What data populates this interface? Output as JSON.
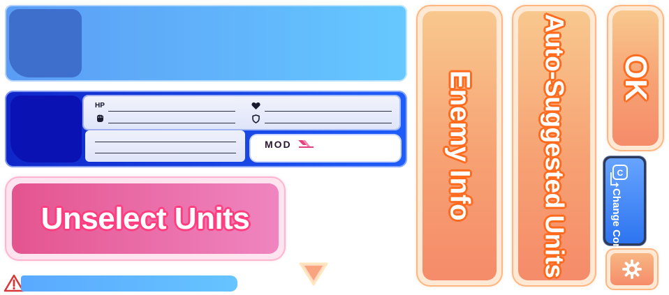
{
  "unit_slots": {
    "detail": {
      "hp_label": "HP",
      "mod_label": "MOD"
    }
  },
  "buttons": {
    "unselect_label": "Unselect Units",
    "enemy_info_label": "Enemy Info",
    "auto_suggested_label": "Auto-Suggested Units",
    "ok_label": "OK",
    "change_content_label": "Change Content"
  },
  "icons": {
    "stat_attack": "fist-icon",
    "stat_heart": "heart-icon",
    "stat_defense": "shield-icon",
    "warning": "warning-triangle-icon",
    "scroll_down": "chevron-down-icon",
    "change_content": "swap-icon",
    "settings": "gear-icon"
  },
  "colors": {
    "slot_blue": "#5a9cf5",
    "slot_selected": "#0f26c8",
    "pink_button": "#e4548f",
    "orange_button": "#f7a173",
    "change_blue": "#2d74f0"
  }
}
